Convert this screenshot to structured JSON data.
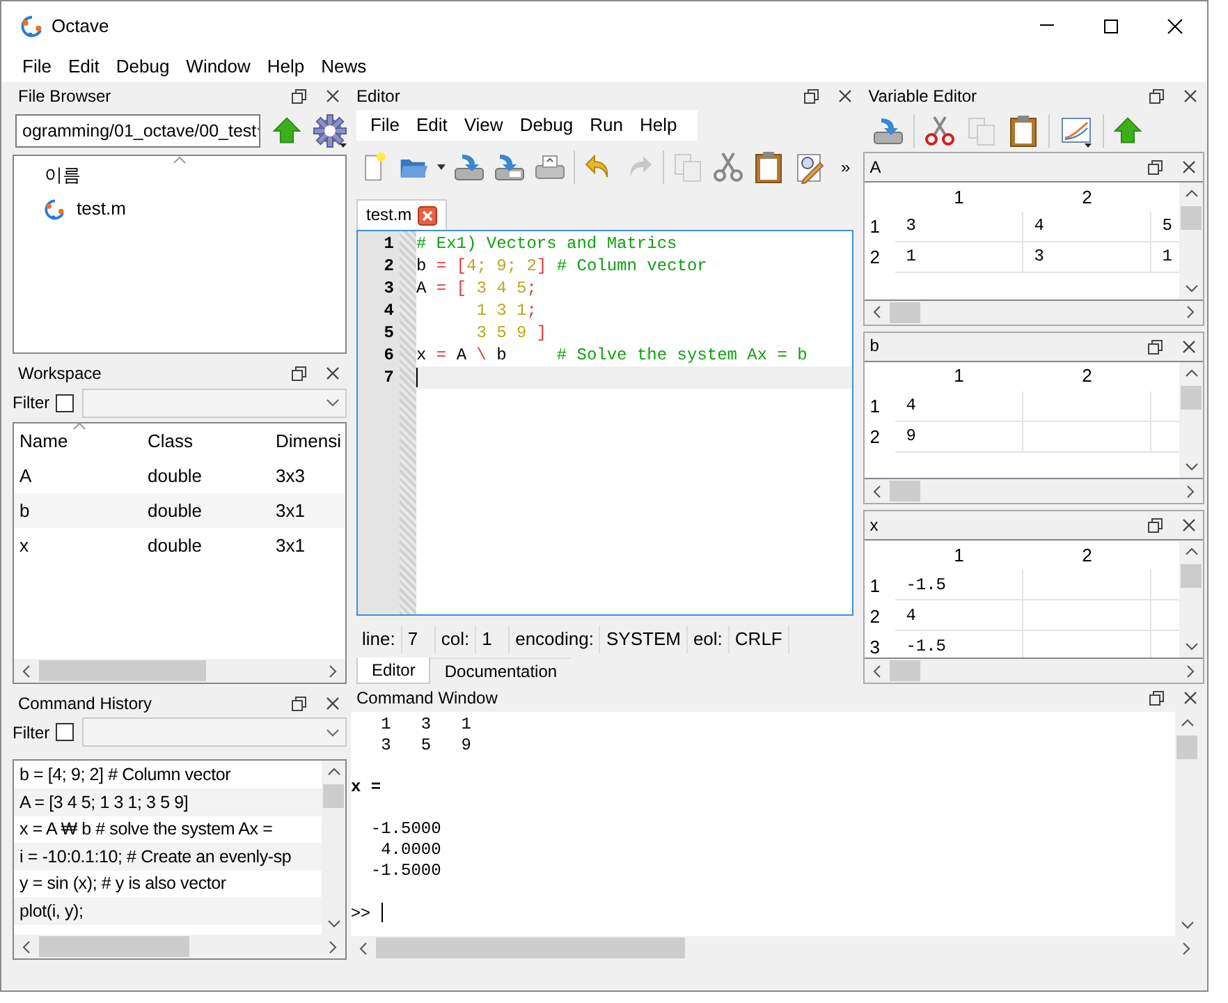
{
  "window": {
    "title": "Octave"
  },
  "menu": [
    "File",
    "Edit",
    "Debug",
    "Window",
    "Help",
    "News"
  ],
  "file_browser": {
    "title": "File Browser",
    "path": "ogramming/01_octave/00_test",
    "column_header": "이름",
    "files": [
      "test.m"
    ]
  },
  "workspace": {
    "title": "Workspace",
    "filter": {
      "label": "Filter",
      "checked": false
    },
    "columns": [
      "Name",
      "Class",
      "Dimensi"
    ],
    "rows": [
      [
        "A",
        "double",
        "3x3"
      ],
      [
        "b",
        "double",
        "3x1"
      ],
      [
        "x",
        "double",
        "3x1"
      ]
    ]
  },
  "command_history": {
    "title": "Command History",
    "filter": {
      "label": "Filter",
      "checked": false
    },
    "entries": [
      "b = [4; 9; 2] # Column vector",
      "A = [3 4 5; 1 3 1; 3 5 9]",
      "x = A ₩ b # solve the system Ax =",
      "i = -10:0.1:10; # Create an evenly-sp",
      "y = sin (x); # y is also vector",
      "plot(i, y);"
    ]
  },
  "editor": {
    "title": "Editor",
    "menu": [
      "File",
      "Edit",
      "View",
      "Debug",
      "Run",
      "Help"
    ],
    "toolbar_overflow": "»",
    "file_tab": "test.m",
    "lines": [
      {
        "number": "1",
        "current": false,
        "tokens": [
          {
            "kind": "comment",
            "text": "# Ex1) Vectors and Matrics"
          }
        ]
      },
      {
        "number": "2",
        "current": false,
        "tokens": [
          {
            "kind": "plain",
            "text": "b"
          },
          {
            "kind": "operator",
            "text": " = ["
          },
          {
            "kind": "number",
            "text": "4; 9; 2"
          },
          {
            "kind": "operator",
            "text": "]"
          },
          {
            "kind": "comment",
            "text": " # Column vector"
          }
        ]
      },
      {
        "number": "3",
        "current": false,
        "tokens": [
          {
            "kind": "plain",
            "text": "A"
          },
          {
            "kind": "operator",
            "text": " = ["
          },
          {
            "kind": "number",
            "text": " 3 4 5"
          },
          {
            "kind": "operator",
            "text": ";"
          }
        ]
      },
      {
        "number": "4",
        "current": false,
        "tokens": [
          {
            "kind": "number",
            "text": "      1 3 1"
          },
          {
            "kind": "operator",
            "text": ";"
          }
        ]
      },
      {
        "number": "5",
        "current": false,
        "tokens": [
          {
            "kind": "number",
            "text": "      3 5 9"
          },
          {
            "kind": "operator",
            "text": " ]"
          }
        ]
      },
      {
        "number": "6",
        "current": false,
        "tokens": [
          {
            "kind": "plain",
            "text": "x"
          },
          {
            "kind": "operator",
            "text": " = "
          },
          {
            "kind": "plain",
            "text": "A "
          },
          {
            "kind": "operator",
            "text": "\\"
          },
          {
            "kind": "plain",
            "text": " b     "
          },
          {
            "kind": "comment",
            "text": "# Solve the system Ax = b"
          }
        ]
      },
      {
        "number": "7",
        "current": true
      }
    ],
    "status": [
      {
        "label": "line:",
        "value": "7"
      },
      {
        "label": "col:",
        "value": "1"
      },
      {
        "label": "encoding:",
        "value": "SYSTEM"
      },
      {
        "label": "eol:",
        "value": "CRLF"
      }
    ],
    "tabs": [
      {
        "label": "Editor",
        "selected": true
      },
      {
        "label": "Documentation",
        "selected": false
      }
    ]
  },
  "variable_editor": {
    "title": "Variable Editor",
    "tables": [
      {
        "name": "A",
        "columns": [
          "1",
          "2"
        ],
        "rows": [
          {
            "label": "1",
            "cells": [
              "3",
              "4",
              "5"
            ]
          },
          {
            "label": "2",
            "cells": [
              "1",
              "3",
              "1"
            ]
          }
        ]
      },
      {
        "name": "b",
        "columns": [
          "1",
          "2"
        ],
        "rows": [
          {
            "label": "1",
            "cells": [
              "4"
            ]
          },
          {
            "label": "2",
            "cells": [
              "9"
            ]
          }
        ]
      },
      {
        "name": "x",
        "columns": [
          "1",
          "2"
        ],
        "rows": [
          {
            "label": "1",
            "cells": [
              "-1.5"
            ]
          },
          {
            "label": "2",
            "cells": [
              "4"
            ]
          },
          {
            "label": "3",
            "cells": [
              "-1.5"
            ]
          }
        ]
      }
    ]
  },
  "command_window": {
    "title": "Command Window",
    "blocks": [
      {
        "kind": "output",
        "lines": [
          "   1   3   1",
          "   3   5   9"
        ]
      },
      {
        "kind": "variable",
        "lines": [
          "x ="
        ]
      },
      {
        "kind": "output",
        "lines": [
          "  -1.5000",
          "   4.0000",
          "  -1.5000"
        ]
      }
    ],
    "prompt": ">>"
  }
}
